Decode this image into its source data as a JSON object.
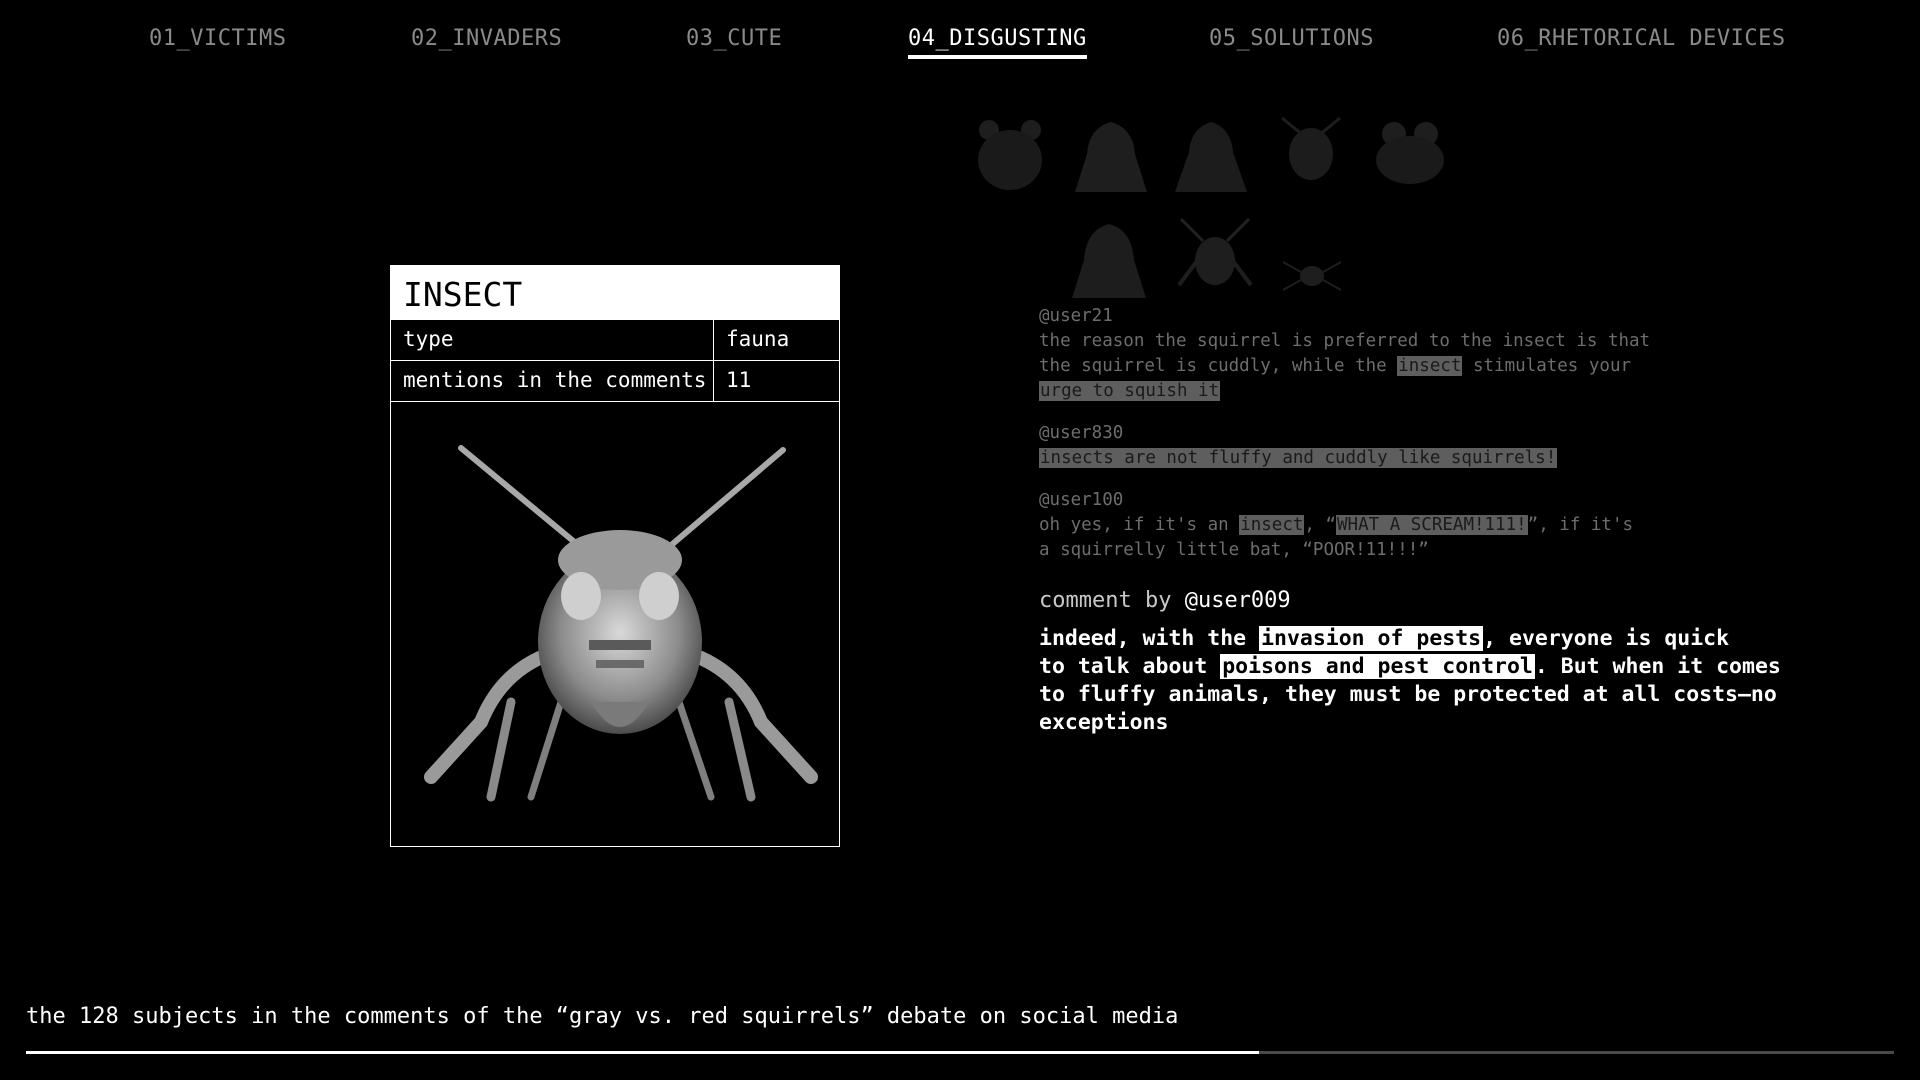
{
  "nav": {
    "items": [
      {
        "label": "01_VICTIMS"
      },
      {
        "label": "02_INVADERS"
      },
      {
        "label": "03_CUTE"
      },
      {
        "label": "04_DISGUSTING",
        "active": true
      },
      {
        "label": "05_SOLUTIONS"
      },
      {
        "label": "06_RHETORICAL DEVICES"
      }
    ]
  },
  "card": {
    "title": "INSECT",
    "rows": [
      {
        "key": "type",
        "value": "fauna"
      },
      {
        "key": "mentions in the comments",
        "value": "11"
      }
    ],
    "image_icon": "cricket-icon"
  },
  "ghost_icons": [
    "hamster-icon",
    "bird-icon",
    "pigeon-icon",
    "beetle-icon",
    "frog-icon",
    "crow-icon",
    "cricket-icon",
    "spider-icon"
  ],
  "faded_comments": [
    {
      "user": "@user21",
      "lines": [
        [
          "the reason the squirrel is preferred to the insect is that"
        ],
        [
          "the squirrel is cuddly, while the ",
          {
            "hl": "insect"
          },
          " stimulates your"
        ],
        [
          {
            "hl": "urge to squish it"
          }
        ]
      ]
    },
    {
      "user": "@user830",
      "lines": [
        [
          {
            "hl": "insects are not fluffy and cuddly like squirrels!"
          }
        ]
      ]
    },
    {
      "user": "@user100",
      "lines": [
        [
          "oh yes, if it's an ",
          {
            "hl": "insect"
          },
          ", “",
          {
            "hl": "WHAT A SCREAM!111!"
          },
          "”, if it's"
        ],
        [
          "a squirrelly little bat, “POOR!11!!!”"
        ]
      ]
    }
  ],
  "main_comment": {
    "by_label": "comment by",
    "user": "@user009",
    "lines": [
      [
        "indeed, with the ",
        {
          "hl": "invasion of pests"
        },
        ", everyone is quick"
      ],
      [
        "to talk about ",
        {
          "hl": "poisons and pest control"
        },
        ". But when it comes"
      ],
      [
        "to fluffy animals, they must be protected at all costs—no"
      ],
      [
        "exceptions"
      ]
    ]
  },
  "footer": {
    "caption": "the 128 subjects in the comments of the “gray vs. red squirrels” debate on social media",
    "progress": 0.66
  },
  "colors": {
    "background": "#000000",
    "text": "#ffffff",
    "nav_inactive": "#8a8a8a",
    "faded_text": "#6d6d6d",
    "progress_track": "#4a4a4a"
  }
}
